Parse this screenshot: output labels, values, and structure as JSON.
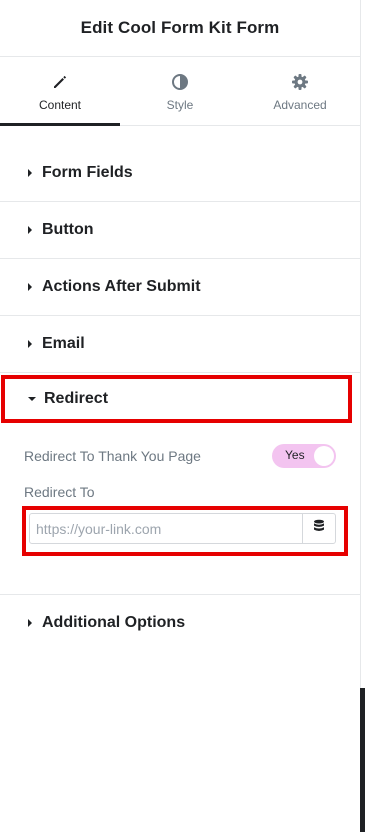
{
  "header": {
    "title": "Edit Cool Form Kit Form"
  },
  "tabs": [
    {
      "label": "Content",
      "icon": "pencil-icon",
      "active": true
    },
    {
      "label": "Style",
      "icon": "contrast-icon",
      "active": false
    },
    {
      "label": "Advanced",
      "icon": "gear-icon",
      "active": false
    }
  ],
  "sections": {
    "form_fields": "Form Fields",
    "button": "Button",
    "actions_after_submit": "Actions After Submit",
    "email": "Email",
    "redirect": "Redirect",
    "additional_options": "Additional Options"
  },
  "redirect": {
    "thank_you_label": "Redirect To Thank You Page",
    "toggle_text": "Yes",
    "toggle_on": true,
    "redirect_to_label": "Redirect To",
    "url_placeholder": "https://your-link.com",
    "url_value": ""
  },
  "colors": {
    "highlight_border": "#e60000",
    "toggle_bg": "#f3c4f0",
    "text": "#1f2124",
    "muted": "#6d7882"
  }
}
